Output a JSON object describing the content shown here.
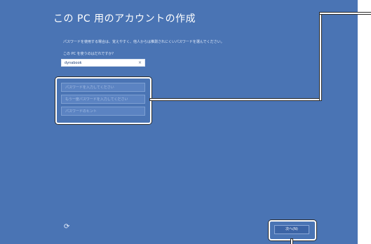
{
  "window": {
    "title": "この PC 用のアカウントの作成"
  },
  "form": {
    "description": "パスワードを使用する場合は、覚えやすく、他人からは推測されにくいパスワードを選んでください。",
    "user_label": "この PC を使うのはだれですか?",
    "user_value": "dynabook",
    "clear_glyph": "×",
    "password_placeholder": "パスワードを入力してください",
    "password_confirm_placeholder": "もう一度パスワードを入力してください",
    "hint_placeholder": "パスワードのヒント"
  },
  "footer": {
    "accessibility_glyph": "⟳",
    "next_label": "次へ(N)"
  },
  "colors": {
    "background": "#4a74b4",
    "callout": "#ffffff"
  },
  "icons": [
    "ease-of-access-icon",
    "clear-icon"
  ]
}
